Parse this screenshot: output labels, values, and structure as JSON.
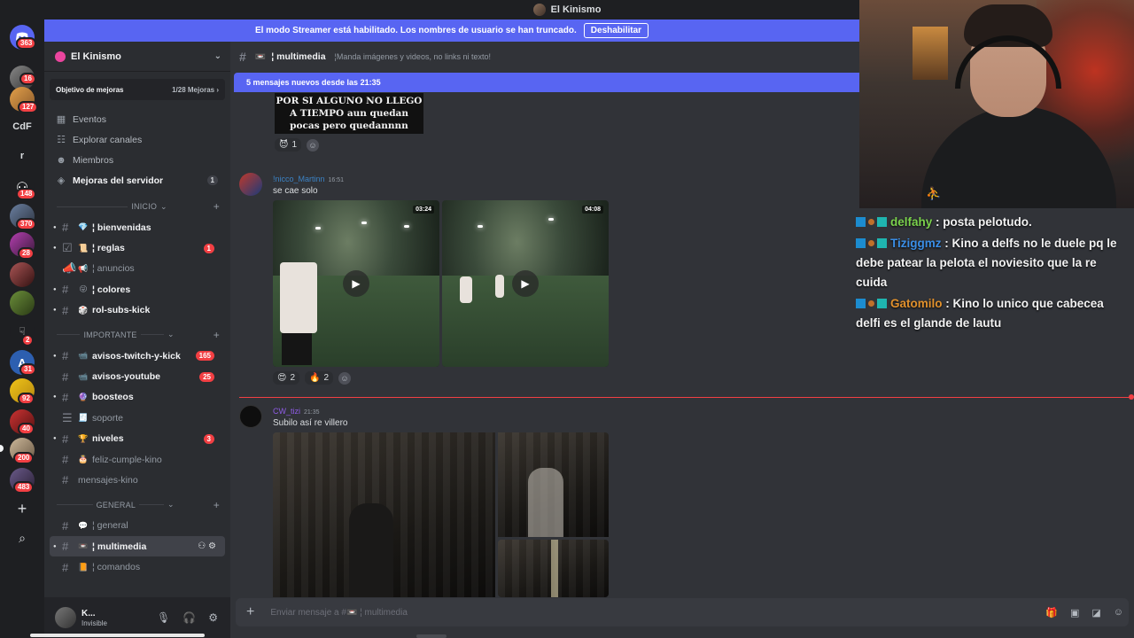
{
  "window": {
    "title": "El Kinismo"
  },
  "streamer_banner": {
    "message": "El modo Streamer está habilitado. Los nombres de usuario se han truncado.",
    "button": "Deshabilitar"
  },
  "rail": {
    "dm_badge": "363",
    "servers": [
      {
        "badge": "16"
      },
      {
        "badge": "127"
      },
      {
        "label": "CdF"
      },
      {
        "label": "r"
      },
      {
        "badge": "148"
      },
      {
        "badge": "370"
      },
      {
        "badge": "28"
      },
      {
        "badge": ""
      },
      {
        "badge": ""
      },
      {
        "badge": "2"
      },
      {
        "badge": "31"
      },
      {
        "badge": "92"
      },
      {
        "badge": "40"
      },
      {
        "badge": "200"
      },
      {
        "badge": "483"
      }
    ],
    "add_label": "+",
    "explore_label": "⌕"
  },
  "sidebar": {
    "server_name": "El Kinismo",
    "boost": {
      "label": "Objetivo de mejoras",
      "progress": "1/28 Mejoras ›"
    },
    "items": [
      {
        "icon": "calendar-icon",
        "label": "Eventos"
      },
      {
        "icon": "compass-icon",
        "label": "Explorar canales"
      },
      {
        "icon": "members-icon",
        "label": "Miembros"
      },
      {
        "icon": "boost-icon",
        "label": "Mejoras del servidor",
        "count": "1"
      }
    ],
    "categories": [
      {
        "name": "INICIO",
        "channels": [
          {
            "emoji": "💎",
            "name": "¦ bienvenidas",
            "unread": true,
            "mention": ""
          },
          {
            "emoji": "📜",
            "name": "¦ reglas",
            "unread": true,
            "mention": "1"
          },
          {
            "emoji": "📢",
            "name": "¦ anuncios",
            "unread": false,
            "mention": ""
          },
          {
            "emoji": "😜",
            "name": "¦ colores",
            "unread": true,
            "mention": ""
          },
          {
            "emoji": "🎲",
            "name": "rol-subs-kick",
            "unread": true,
            "mention": ""
          }
        ]
      },
      {
        "name": "IMPORTANTE",
        "channels": [
          {
            "emoji": "📹",
            "name": "avisos-twitch-y-kick",
            "unread": true,
            "mention": "165"
          },
          {
            "emoji": "📹",
            "name": "avisos-youtube",
            "unread": true,
            "mention": "25"
          },
          {
            "emoji": "🔮",
            "name": "boosteos",
            "unread": true,
            "mention": ""
          },
          {
            "emoji": "🧾",
            "name": "soporte",
            "unread": false,
            "mention": ""
          },
          {
            "emoji": "🏆",
            "name": "niveles",
            "unread": true,
            "mention": "3"
          },
          {
            "emoji": "🎂",
            "name": "feliz-cumple-kino",
            "unread": false,
            "mention": ""
          },
          {
            "emoji": "",
            "name": "mensajes-kino",
            "unread": false,
            "mention": ""
          }
        ]
      },
      {
        "name": "GENERAL",
        "channels": [
          {
            "emoji": "💬",
            "name": "¦ general",
            "unread": false,
            "mention": ""
          },
          {
            "emoji": "📼",
            "name": "¦ multimedia",
            "unread": false,
            "active": true,
            "mention": ""
          },
          {
            "emoji": "📙",
            "name": "¦ comandos",
            "unread": false,
            "mention": ""
          }
        ]
      }
    ],
    "user": {
      "name": "K...",
      "status": "Invisible"
    }
  },
  "chat": {
    "channel_name": "¦ multimedia",
    "topic": "¦Manda imágenes y videos, no links ni texto!",
    "new_messages": "5 mensajes nuevos desde las 21:35",
    "top_image_text": [
      "POR SI ALGUNO NO LLEGO",
      "A TIEMPO aun quedan",
      "pocas pero quedannnn"
    ],
    "top_reaction": {
      "emoji": "😈",
      "count": "1"
    },
    "messages": [
      {
        "author": "!nicco_Martinn",
        "author_color": "#3b82c4",
        "time": "16:51",
        "text": "se cae solo",
        "videos": [
          {
            "duration": "03:24"
          },
          {
            "duration": "04:08"
          }
        ],
        "reactions": [
          {
            "emoji": "😍",
            "count": "2"
          },
          {
            "emoji": "🔥",
            "count": "2"
          }
        ]
      },
      {
        "author": "CW_tizi",
        "author_color": "#8f5ce6",
        "time": "21:35",
        "text": "Subilo así re villero"
      }
    ],
    "composer_placeholder": "Enviar mensaje a #📼 ¦ multimedia"
  },
  "overlay_chat": [
    {
      "user": "delfahy",
      "color": "#7bd24d",
      "message": ": posta pelotudo."
    },
    {
      "user": "Tiziggmz",
      "color": "#3a8ee6",
      "message": ": Kino a delfs no le duele pq le debe patear la pelota el noviesito que la re cuida"
    },
    {
      "user": "Gatomilo",
      "color": "#e0902c",
      "message": ": Kino lo unico que cabecea delfi es el glande de lautu"
    }
  ]
}
